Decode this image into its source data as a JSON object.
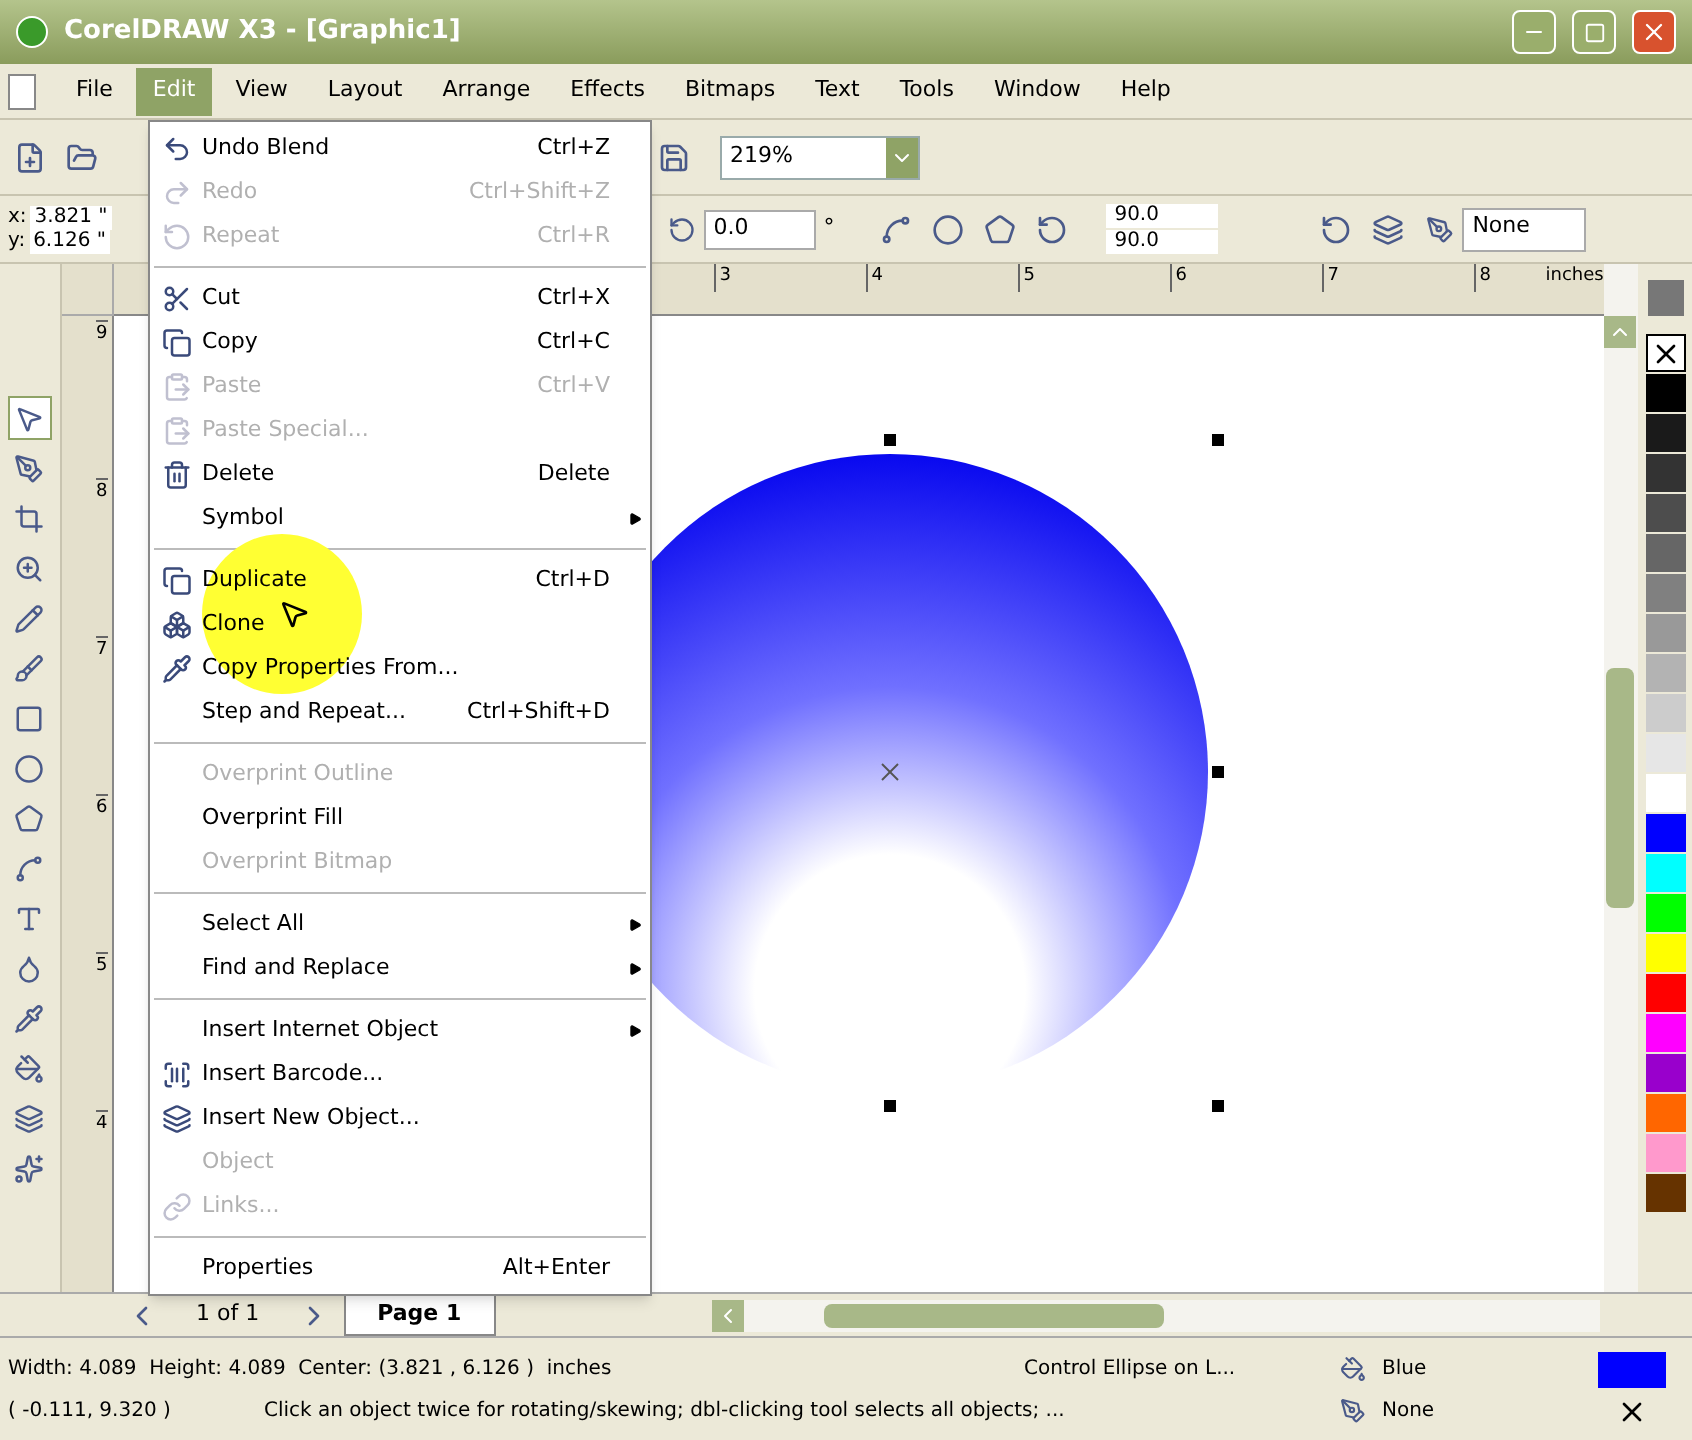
{
  "window": {
    "title": "CorelDRAW X3 - [Graphic1]"
  },
  "menu_bar": [
    {
      "label": "File",
      "selected": false
    },
    {
      "label": "Edit",
      "selected": true
    },
    {
      "label": "View",
      "selected": false
    },
    {
      "label": "Layout",
      "selected": false
    },
    {
      "label": "Arrange",
      "selected": false
    },
    {
      "label": "Effects",
      "selected": false
    },
    {
      "label": "Bitmaps",
      "selected": false
    },
    {
      "label": "Text",
      "selected": false
    },
    {
      "label": "Tools",
      "selected": false
    },
    {
      "label": "Window",
      "selected": false
    },
    {
      "label": "Help",
      "selected": false
    }
  ],
  "toolbar": {
    "zoom": "219%"
  },
  "property_bar": {
    "x_label": "x:",
    "x": "3.821 \"",
    "y_label": "y:",
    "y": "6.126 \"",
    "rotation": "0.0",
    "degree": "°",
    "start_angle": "90.0",
    "end_angle": "90.0",
    "outline": "None"
  },
  "edit_menu": [
    {
      "kind": "item",
      "label": "Undo Blend",
      "shortcut": "Ctrl+Z",
      "disabled": false,
      "submenu": false
    },
    {
      "kind": "item",
      "label": "Redo",
      "shortcut": "Ctrl+Shift+Z",
      "disabled": true,
      "submenu": false
    },
    {
      "kind": "item",
      "label": "Repeat",
      "shortcut": "Ctrl+R",
      "disabled": true,
      "submenu": false
    },
    {
      "kind": "separator"
    },
    {
      "kind": "item",
      "label": "Cut",
      "shortcut": "Ctrl+X",
      "disabled": false,
      "submenu": false
    },
    {
      "kind": "item",
      "label": "Copy",
      "shortcut": "Ctrl+C",
      "disabled": false,
      "submenu": false
    },
    {
      "kind": "item",
      "label": "Paste",
      "shortcut": "Ctrl+V",
      "disabled": true,
      "submenu": false
    },
    {
      "kind": "item",
      "label": "Paste Special...",
      "disabled": true,
      "submenu": false
    },
    {
      "kind": "item",
      "label": "Delete",
      "shortcut": "Delete",
      "disabled": false,
      "submenu": false
    },
    {
      "kind": "item",
      "label": "Symbol",
      "disabled": false,
      "submenu": true
    },
    {
      "kind": "separator"
    },
    {
      "kind": "item",
      "label": "Duplicate",
      "shortcut": "Ctrl+D",
      "disabled": false,
      "submenu": false
    },
    {
      "kind": "item",
      "label": "Clone",
      "disabled": false,
      "submenu": false
    },
    {
      "kind": "item",
      "label": "Copy Properties From...",
      "disabled": false,
      "submenu": false
    },
    {
      "kind": "item",
      "label": "Step and Repeat...",
      "shortcut": "Ctrl+Shift+D",
      "disabled": false,
      "submenu": false
    },
    {
      "kind": "separator"
    },
    {
      "kind": "item",
      "label": "Overprint Outline",
      "disabled": true,
      "submenu": false
    },
    {
      "kind": "item",
      "label": "Overprint Fill",
      "disabled": false,
      "submenu": false
    },
    {
      "kind": "item",
      "label": "Overprint Bitmap",
      "disabled": true,
      "submenu": false
    },
    {
      "kind": "separator"
    },
    {
      "kind": "item",
      "label": "Select All",
      "disabled": false,
      "submenu": true
    },
    {
      "kind": "item",
      "label": "Find and Replace",
      "disabled": false,
      "submenu": true
    },
    {
      "kind": "separator"
    },
    {
      "kind": "item",
      "label": "Insert Internet Object",
      "disabled": false,
      "submenu": true
    },
    {
      "kind": "item",
      "label": "Insert Barcode...",
      "disabled": false,
      "submenu": false
    },
    {
      "kind": "item",
      "label": "Insert New Object...",
      "disabled": false,
      "submenu": false
    },
    {
      "kind": "item",
      "label": "Object",
      "disabled": true,
      "submenu": false
    },
    {
      "kind": "item",
      "label": "Links...",
      "disabled": true,
      "submenu": false
    },
    {
      "kind": "separator"
    },
    {
      "kind": "item",
      "label": "Properties",
      "shortcut": "Alt+Enter",
      "disabled": false,
      "submenu": false
    }
  ],
  "toolbox": [
    {
      "selected": true
    },
    {
      "selected": false
    },
    {
      "selected": false
    },
    {
      "selected": false
    },
    {
      "selected": false
    },
    {
      "selected": false
    },
    {
      "selected": false
    },
    {
      "selected": false
    },
    {
      "selected": false
    },
    {
      "selected": false
    },
    {
      "selected": false
    },
    {
      "selected": false
    },
    {
      "selected": false
    },
    {
      "selected": false
    },
    {
      "selected": false
    },
    {
      "selected": false
    }
  ],
  "horizontal_ruler": {
    "labels": [
      "3",
      "4",
      "5",
      "6",
      "7",
      "8"
    ],
    "unit": "inches"
  },
  "vertical_ruler": {
    "labels": [
      "9",
      "8",
      "7",
      "6",
      "5",
      "4"
    ]
  },
  "palette": [
    {
      "kind": "none",
      "color": "#ffffff"
    },
    {
      "kind": "swatch",
      "color": "#000000"
    },
    {
      "kind": "swatch",
      "color": "#1a1a1a"
    },
    {
      "kind": "swatch",
      "color": "#333333"
    },
    {
      "kind": "swatch",
      "color": "#4d4d4d"
    },
    {
      "kind": "swatch",
      "color": "#666666"
    },
    {
      "kind": "swatch",
      "color": "#808080"
    },
    {
      "kind": "swatch",
      "color": "#999999"
    },
    {
      "kind": "swatch",
      "color": "#b3b3b3"
    },
    {
      "kind": "swatch",
      "color": "#cccccc"
    },
    {
      "kind": "swatch",
      "color": "#e6e6e6"
    },
    {
      "kind": "swatch",
      "color": "#ffffff"
    },
    {
      "kind": "swatch",
      "color": "#0000ff"
    },
    {
      "kind": "swatch",
      "color": "#00ffff"
    },
    {
      "kind": "swatch",
      "color": "#00ff00"
    },
    {
      "kind": "swatch",
      "color": "#ffff00"
    },
    {
      "kind": "swatch",
      "color": "#ff0000"
    },
    {
      "kind": "swatch",
      "color": "#ff00ff"
    },
    {
      "kind": "swatch",
      "color": "#9900cc"
    },
    {
      "kind": "swatch",
      "color": "#ff6600"
    },
    {
      "kind": "swatch",
      "color": "#ff99cc"
    },
    {
      "kind": "swatch",
      "color": "#663300"
    }
  ],
  "page_nav": {
    "count": "1 of 1",
    "tab": "Page 1"
  },
  "status_bar": {
    "size": "Width: 4.089  Height: 4.089  Center: (3.821 , 6.126 )  inches",
    "object": "Control Ellipse on L...",
    "fill": "Blue",
    "fill_swatch": {
      "color": "#0000ff"
    },
    "position": "( -0.111, 9.320 )",
    "hint": "Click an object twice for rotating/skewing; dbl-clicking tool selects all objects; ...",
    "outline": "None"
  }
}
